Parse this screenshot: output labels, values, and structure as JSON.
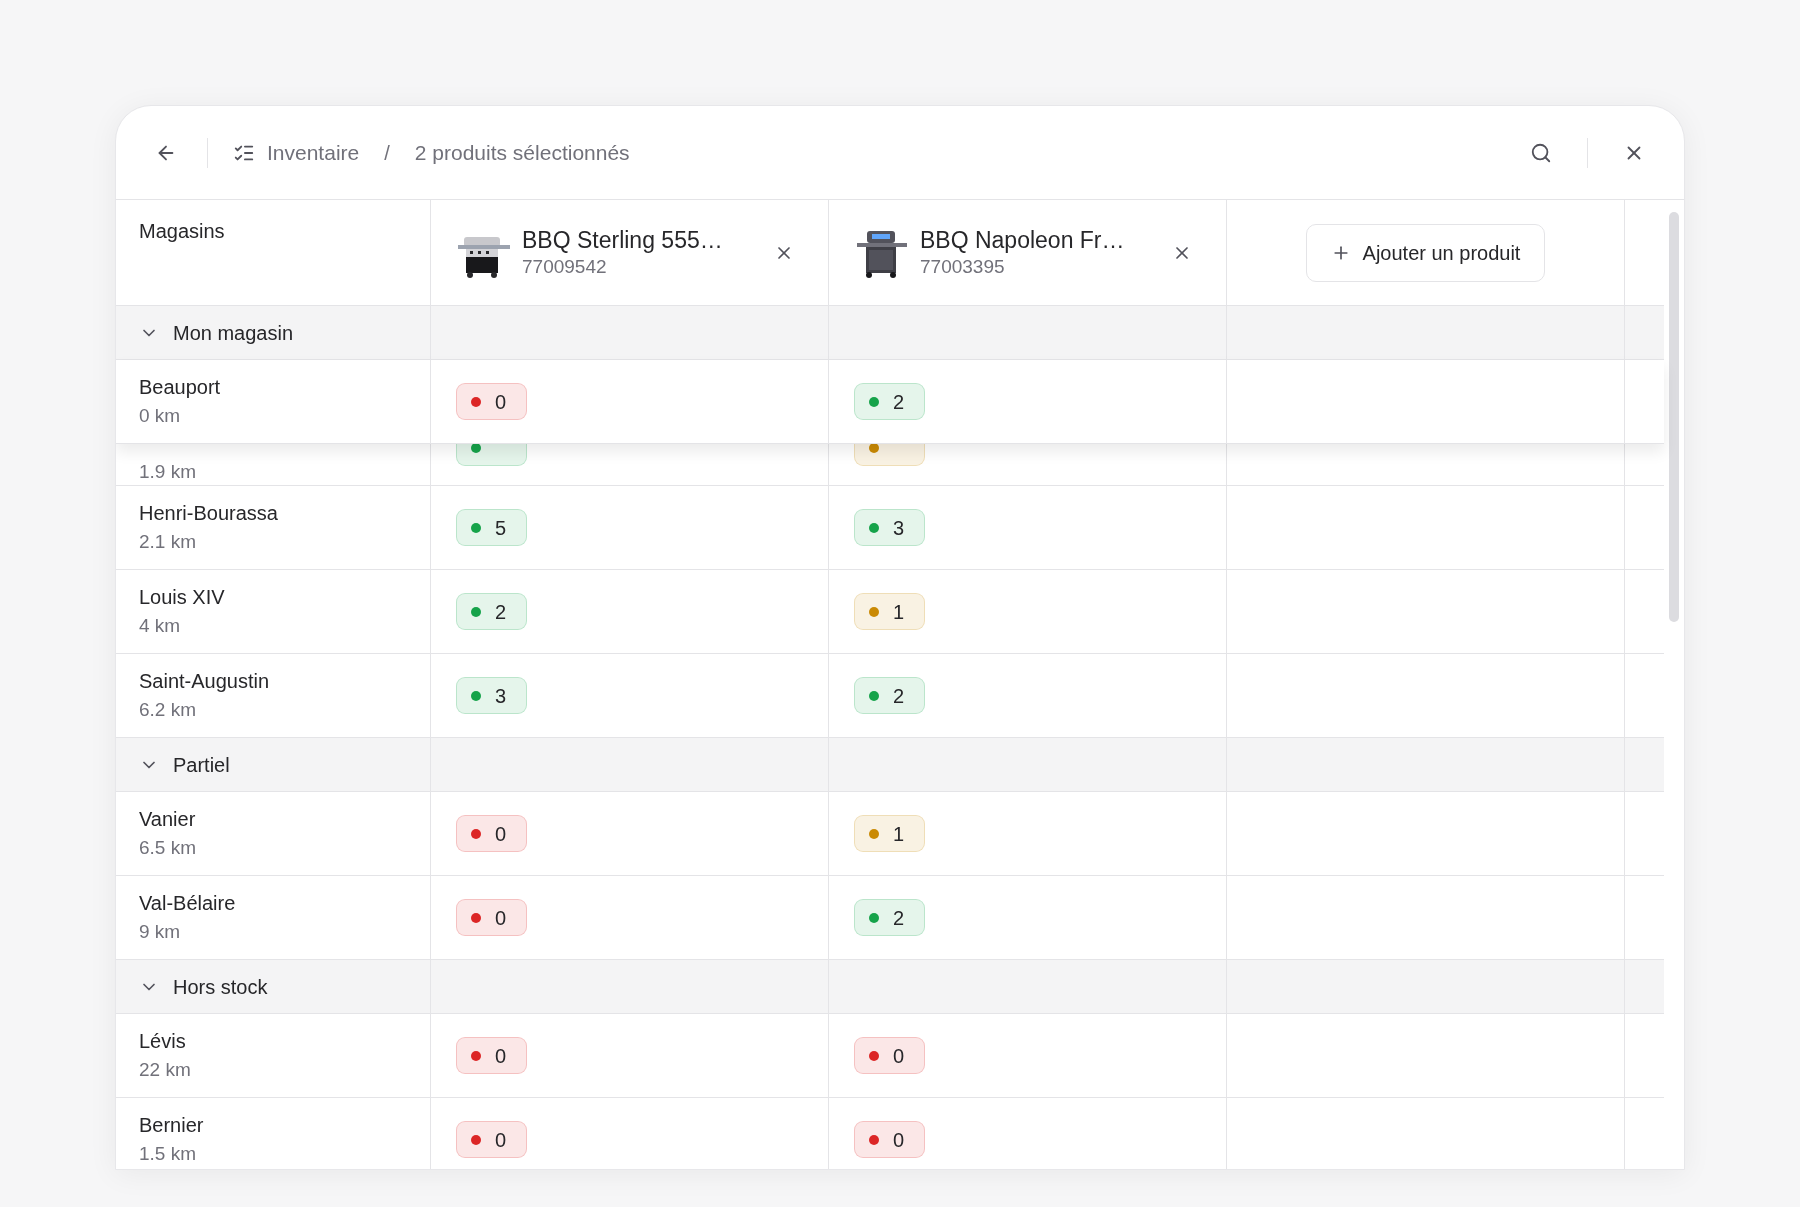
{
  "header": {
    "breadcrumb": [
      {
        "label": "Inventaire"
      },
      {
        "label": "2 produits sélectionnés"
      }
    ],
    "separator": "/"
  },
  "columns": {
    "stores_label": "Magasins",
    "products": [
      {
        "name": "BBQ Sterling 555…",
        "sku": "77009542",
        "kind": "open"
      },
      {
        "name": "BBQ Napoleon Fr…",
        "sku": "77003395",
        "kind": "closed"
      }
    ],
    "add_button": "Ajouter un produit"
  },
  "groups": [
    {
      "label": "Mon magasin",
      "expanded": true,
      "rows": [
        {
          "kind": "pinned",
          "name": "Beauport",
          "distance": "0 km",
          "stock": [
            {
              "color": "#dc2626",
              "value": "0"
            },
            {
              "color": "#16a34a",
              "value": "2"
            }
          ]
        },
        {
          "kind": "covered",
          "distance": "1.9 km",
          "stock": [
            {
              "color": "#16a34a"
            },
            {
              "color": "#ca8a04"
            }
          ]
        },
        {
          "kind": "normal",
          "name": "Henri-Bourassa",
          "distance": "2.1 km",
          "stock": [
            {
              "color": "#16a34a",
              "value": "5"
            },
            {
              "color": "#16a34a",
              "value": "3"
            }
          ]
        },
        {
          "kind": "normal",
          "name": "Louis XIV",
          "distance": "4 km",
          "stock": [
            {
              "color": "#16a34a",
              "value": "2"
            },
            {
              "color": "#ca8a04",
              "value": "1"
            }
          ]
        },
        {
          "kind": "normal",
          "name": "Saint-Augustin",
          "distance": "6.2 km",
          "stock": [
            {
              "color": "#16a34a",
              "value": "3"
            },
            {
              "color": "#16a34a",
              "value": "2"
            }
          ]
        }
      ]
    },
    {
      "label": "Partiel",
      "expanded": true,
      "rows": [
        {
          "kind": "normal",
          "name": "Vanier",
          "distance": "6.5 km",
          "stock": [
            {
              "color": "#dc2626",
              "value": "0"
            },
            {
              "color": "#ca8a04",
              "value": "1"
            }
          ]
        },
        {
          "kind": "normal",
          "name": "Val-Bélaire",
          "distance": "9 km",
          "stock": [
            {
              "color": "#dc2626",
              "value": "0"
            },
            {
              "color": "#16a34a",
              "value": "2"
            }
          ]
        }
      ]
    },
    {
      "label": "Hors stock",
      "expanded": true,
      "rows": [
        {
          "kind": "normal",
          "name": "Lévis",
          "distance": "22 km",
          "stock": [
            {
              "color": "#dc2626",
              "value": "0"
            },
            {
              "color": "#dc2626",
              "value": "0"
            }
          ]
        },
        {
          "kind": "normal",
          "name": "Bernier",
          "distance": "1.5 km",
          "stock": [
            {
              "color": "#dc2626",
              "value": "0"
            },
            {
              "color": "#dc2626",
              "value": "0"
            }
          ]
        }
      ]
    }
  ]
}
